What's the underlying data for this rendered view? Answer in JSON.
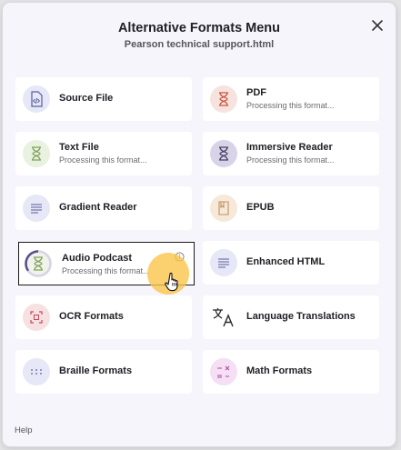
{
  "modal": {
    "title": "Alternative Formats Menu",
    "subtitle": "Pearson technical support.html"
  },
  "formats": [
    {
      "label": "Source File",
      "status": ""
    },
    {
      "label": "PDF",
      "status": "Processing this format..."
    },
    {
      "label": "Text File",
      "status": "Processing this format..."
    },
    {
      "label": "Immersive Reader",
      "status": "Processing this format..."
    },
    {
      "label": "Gradient Reader",
      "status": ""
    },
    {
      "label": "EPUB",
      "status": ""
    },
    {
      "label": "Audio Podcast",
      "status": "Processing this format..."
    },
    {
      "label": "Enhanced HTML",
      "status": ""
    },
    {
      "label": "OCR Formats",
      "status": ""
    },
    {
      "label": "Language Translations",
      "status": ""
    },
    {
      "label": "Braille Formats",
      "status": ""
    },
    {
      "label": "Math Formats",
      "status": ""
    }
  ],
  "footer": {
    "help": "Help"
  },
  "colors": {
    "accent_cursor": "#FAC446",
    "selected_border": "#1A1A1A"
  }
}
